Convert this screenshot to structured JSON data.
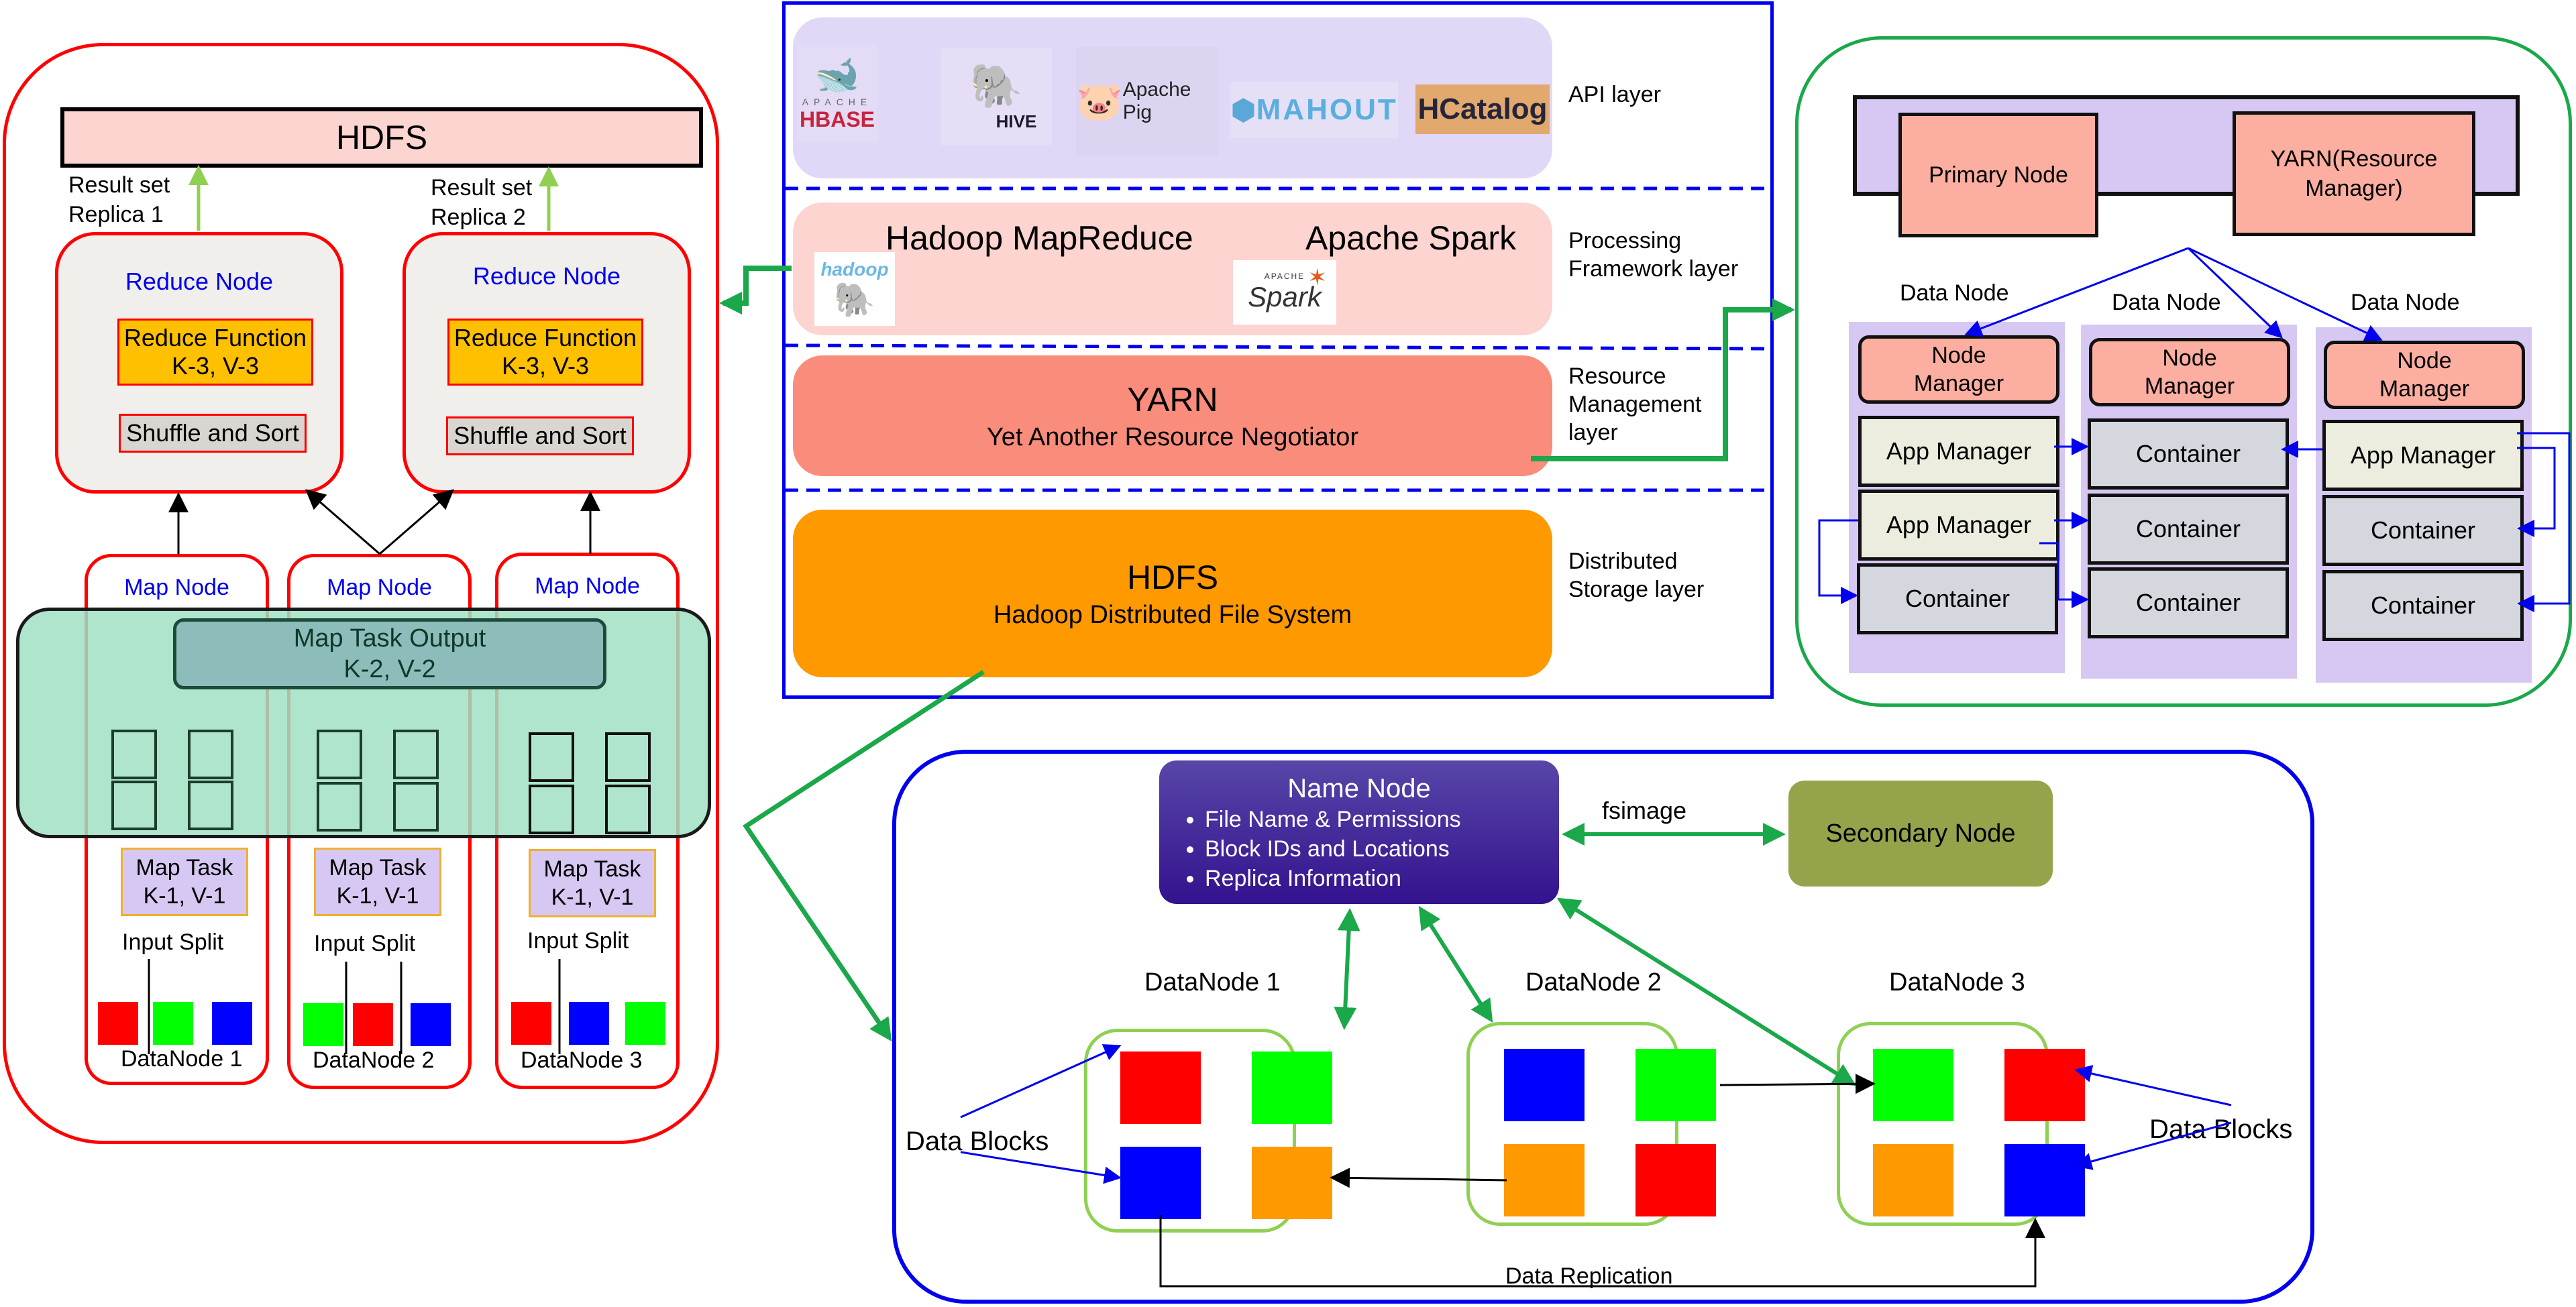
{
  "mapreduce_panel": {
    "hdfs_label": "HDFS",
    "result_sets": [
      {
        "line1": "Result set",
        "line2": "Replica 1"
      },
      {
        "line1": "Result set",
        "line2": "Replica 2"
      }
    ],
    "reduce_nodes": [
      {
        "title": "Reduce Node",
        "function_line1": "Reduce Function",
        "function_line2": "K-3, V-3",
        "shuffle": "Shuffle and Sort"
      },
      {
        "title": "Reduce Node",
        "function_line1": "Reduce Function",
        "function_line2": "K-3, V-3",
        "shuffle": "Shuffle and Sort"
      }
    ],
    "map_task_output": {
      "line1": "Map Task Output",
      "line2": "K-2, V-2"
    },
    "map_nodes": [
      {
        "title": "Map Node",
        "task_line1": "Map Task",
        "task_line2": "K-1, V-1",
        "input_split": "Input Split",
        "datanode": "DataNode 1",
        "blocks": [
          "red",
          "green",
          "blue"
        ]
      },
      {
        "title": "Map Node",
        "task_line1": "Map Task",
        "task_line2": "K-1, V-1",
        "input_split": "Input Split",
        "datanode": "DataNode 2",
        "blocks": [
          "green",
          "red",
          "blue"
        ]
      },
      {
        "title": "Map Node",
        "task_line1": "Map Task",
        "task_line2": "K-1, V-1",
        "input_split": "Input Split",
        "datanode": "DataNode 3",
        "blocks": [
          "red",
          "blue",
          "green"
        ]
      }
    ]
  },
  "stack_panel": {
    "api_layer": {
      "label": "API layer",
      "logos": [
        {
          "name": "hbase-logo",
          "top": "APACHE",
          "text": "HBASE"
        },
        {
          "name": "hive-logo",
          "text": "HIVE"
        },
        {
          "name": "pig-logo",
          "text": "Apache Pig"
        },
        {
          "name": "mahout-logo",
          "text": "MAHOUT"
        },
        {
          "name": "hcatalog-logo",
          "text": "HCatalog"
        }
      ]
    },
    "processing_layer": {
      "label_line1": "Processing",
      "label_line2": "Framework layer",
      "frameworks": [
        {
          "title": "Hadoop MapReduce",
          "logo_text": "hadoop"
        },
        {
          "title": "Apache Spark",
          "logo_top": "APACHE",
          "logo_text": "Spark"
        }
      ]
    },
    "resource_layer": {
      "label_line1": "Resource",
      "label_line2": "Management",
      "label_line3": "layer",
      "title": "YARN",
      "subtitle": "Yet Another Resource Negotiator"
    },
    "storage_layer": {
      "label_line1": "Distributed",
      "label_line2": "Storage layer",
      "title": "HDFS",
      "subtitle": "Hadoop Distributed File System"
    }
  },
  "yarn_panel": {
    "primary_node": "Primary Node",
    "resource_manager_line1": "YARN(Resource",
    "resource_manager_line2": "Manager)",
    "data_nodes": [
      {
        "label": "Data Node",
        "node_manager_line1": "Node",
        "node_manager_line2": "Manager",
        "rows": [
          "App Manager",
          "App Manager",
          "Container"
        ]
      },
      {
        "label": "Data Node",
        "node_manager_line1": "Node",
        "node_manager_line2": "Manager",
        "rows": [
          "Container",
          "Container",
          "Container"
        ]
      },
      {
        "label": "Data Node",
        "node_manager_line1": "Node",
        "node_manager_line2": "Manager",
        "rows": [
          "App Manager",
          "Container",
          "Container"
        ]
      }
    ]
  },
  "hdfs_panel": {
    "name_node": {
      "title": "Name Node",
      "items": [
        "File Name & Permissions",
        "Block IDs and Locations",
        "Replica Information"
      ]
    },
    "fsimage_label": "fsimage",
    "secondary_node": "Secondary Node",
    "datanodes": [
      {
        "label": "DataNode 1",
        "blocks": [
          "red",
          "green",
          "blue",
          "orange"
        ]
      },
      {
        "label": "DataNode 2",
        "blocks": [
          "blue",
          "green",
          "orange",
          "red"
        ]
      },
      {
        "label": "DataNode 3",
        "blocks": [
          "green",
          "red",
          "orange",
          "blue"
        ]
      }
    ],
    "data_blocks_label": "Data Blocks",
    "replication_label": "Data Replication"
  },
  "colors": {
    "red": "#ff0000",
    "green": "#00ff00",
    "blue": "#0000ff",
    "orange": "#ff9900",
    "connector_green": "#1aa84a",
    "panel_blue": "#0000ee"
  }
}
